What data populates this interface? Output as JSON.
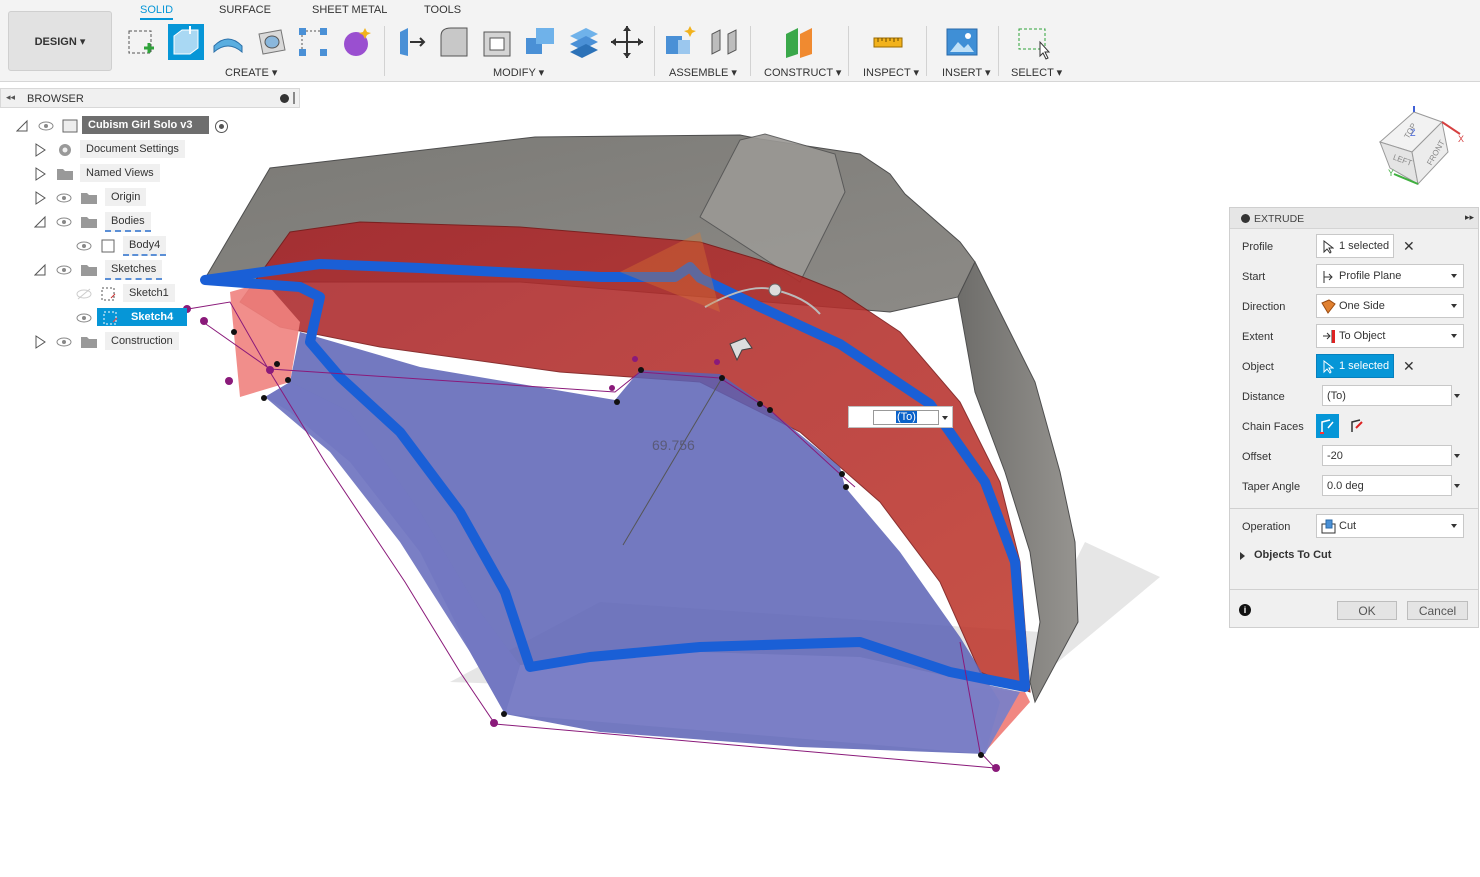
{
  "toolbar": {
    "design_label": "DESIGN ▾",
    "tabs": [
      "SOLID",
      "SURFACE",
      "SHEET METAL",
      "TOOLS"
    ],
    "groups": [
      "CREATE ▾",
      "MODIFY ▾",
      "ASSEMBLE ▾",
      "CONSTRUCT ▾",
      "INSPECT ▾",
      "INSERT ▾",
      "SELECT ▾"
    ]
  },
  "browser": {
    "title": "BROWSER",
    "root": "Cubism Girl Solo v3",
    "items": [
      "Document Settings",
      "Named Views",
      "Origin",
      "Bodies",
      "Body4",
      "Sketches",
      "Sketch1",
      "Sketch4",
      "Construction"
    ]
  },
  "viewport": {
    "dimension_label": "69.756",
    "inline_field_value": "(To)"
  },
  "viewcube": {
    "faces": [
      "TOP",
      "LEFT",
      "FRONT"
    ],
    "axes": [
      "X",
      "Y",
      "Z"
    ]
  },
  "extrude": {
    "title": "EXTRUDE",
    "profile_label": "Profile",
    "profile_value": "1 selected",
    "start_label": "Start",
    "start_value": "Profile Plane",
    "direction_label": "Direction",
    "direction_value": "One Side",
    "extent_label": "Extent",
    "extent_value": "To Object",
    "object_label": "Object",
    "object_value": "1 selected",
    "distance_label": "Distance",
    "distance_value": "(To)",
    "chain_label": "Chain Faces",
    "offset_label": "Offset",
    "offset_value": "-20",
    "taper_label": "Taper Angle",
    "taper_value": "0.0 deg",
    "operation_label": "Operation",
    "operation_value": "Cut",
    "objects_to_cut_label": "Objects To Cut",
    "ok_label": "OK",
    "cancel_label": "Cancel"
  },
  "colors": {
    "accent": "#0696d7",
    "cut_red": "#b22424",
    "profile_blue": "#1a5fd6",
    "body_gray": "#8d8b87"
  }
}
